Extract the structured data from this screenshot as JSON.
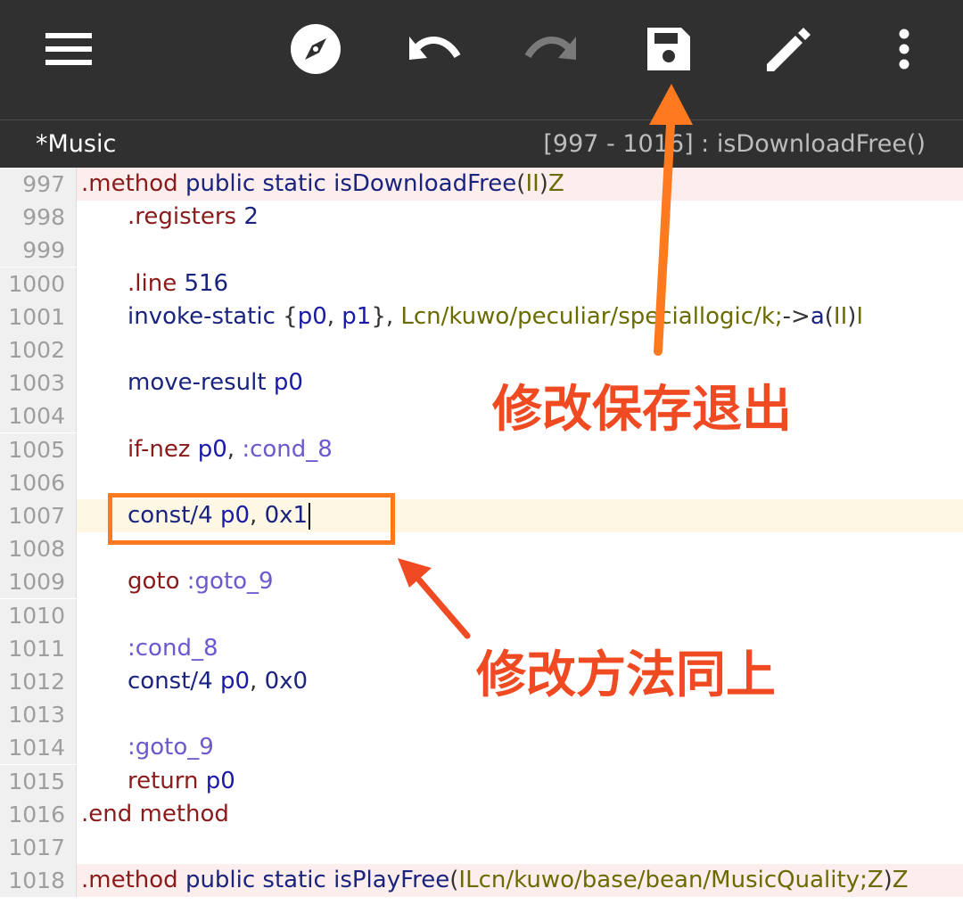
{
  "toolbar": {
    "icons": [
      "hamburger-menu-icon",
      "compass-icon",
      "undo-icon",
      "redo-icon",
      "save-icon",
      "pencil-icon",
      "more-vert-icon"
    ]
  },
  "subbar": {
    "filename": "*Music",
    "location": "[997 - 1016] : isDownloadFree()"
  },
  "editor": {
    "lines": [
      {
        "n": "997",
        "segs": [
          [
            "dir",
            ".method "
          ],
          [
            "kw",
            "public static "
          ],
          [
            "kw",
            "isDownloadFree"
          ],
          [
            "pu",
            "("
          ],
          [
            "ty",
            "II"
          ],
          [
            "pu",
            ")"
          ],
          [
            "ty",
            "Z"
          ]
        ]
      },
      {
        "n": "998",
        "segs": [
          [
            "dir",
            ".registers "
          ],
          [
            "num",
            "2"
          ]
        ]
      },
      {
        "n": "999",
        "segs": []
      },
      {
        "n": "1000",
        "segs": [
          [
            "dir",
            ".line "
          ],
          [
            "num",
            "516"
          ]
        ]
      },
      {
        "n": "1001",
        "segs": [
          [
            "kw",
            "invoke-static "
          ],
          [
            "pu",
            "{"
          ],
          [
            "reg",
            "p0"
          ],
          [
            "pu",
            ", "
          ],
          [
            "reg",
            "p1"
          ],
          [
            "pu",
            "}, "
          ],
          [
            "ty",
            "Lcn/kuwo/peculiar/speciallogic/k;"
          ],
          [
            "pu",
            "->"
          ],
          [
            "kw",
            "a"
          ],
          [
            "pu",
            "("
          ],
          [
            "ty",
            "II"
          ],
          [
            "pu",
            ")"
          ],
          [
            "ty",
            "I"
          ]
        ]
      },
      {
        "n": "1002",
        "segs": []
      },
      {
        "n": "1003",
        "segs": [
          [
            "kw",
            "move-result "
          ],
          [
            "reg",
            "p0"
          ]
        ]
      },
      {
        "n": "1004",
        "segs": []
      },
      {
        "n": "1005",
        "segs": [
          [
            "dir",
            "if-nez "
          ],
          [
            "reg",
            "p0"
          ],
          [
            "pu",
            ", "
          ],
          [
            "lbl",
            ":cond_8"
          ]
        ]
      },
      {
        "n": "1006",
        "segs": []
      },
      {
        "n": "1007",
        "segs": [
          [
            "kw",
            "const/4 "
          ],
          [
            "reg",
            "p0"
          ],
          [
            "pu",
            ", "
          ],
          [
            "num",
            "0x1"
          ]
        ]
      },
      {
        "n": "1008",
        "segs": []
      },
      {
        "n": "1009",
        "segs": [
          [
            "dir",
            "goto "
          ],
          [
            "lbl",
            ":goto_9"
          ]
        ]
      },
      {
        "n": "1010",
        "segs": []
      },
      {
        "n": "1011",
        "segs": [
          [
            "lbl",
            ":cond_8"
          ]
        ]
      },
      {
        "n": "1012",
        "segs": [
          [
            "kw",
            "const/4 "
          ],
          [
            "reg",
            "p0"
          ],
          [
            "pu",
            ", "
          ],
          [
            "num",
            "0x0"
          ]
        ]
      },
      {
        "n": "1013",
        "segs": []
      },
      {
        "n": "1014",
        "segs": [
          [
            "lbl",
            ":goto_9"
          ]
        ]
      },
      {
        "n": "1015",
        "segs": [
          [
            "dir",
            "return "
          ],
          [
            "reg",
            "p0"
          ]
        ]
      },
      {
        "n": "1016",
        "segs": [
          [
            "dir",
            ".end method"
          ]
        ]
      },
      {
        "n": "1017",
        "segs": []
      },
      {
        "n": "1018",
        "segs": [
          [
            "dir",
            ".method "
          ],
          [
            "kw",
            "public static "
          ],
          [
            "kw",
            "isPlayFree"
          ],
          [
            "pu",
            "("
          ],
          [
            "ty",
            "ILcn/kuwo/base/bean/MusicQuality;Z"
          ],
          [
            "pu",
            ")"
          ],
          [
            "ty",
            "Z"
          ]
        ]
      }
    ]
  },
  "annotations": {
    "save_note": "修改保存退出",
    "method_note": "修改方法同上"
  },
  "colors": {
    "annotation": "#f04a22",
    "box": "#ff7a1f",
    "toolbar_bg": "#303030"
  }
}
